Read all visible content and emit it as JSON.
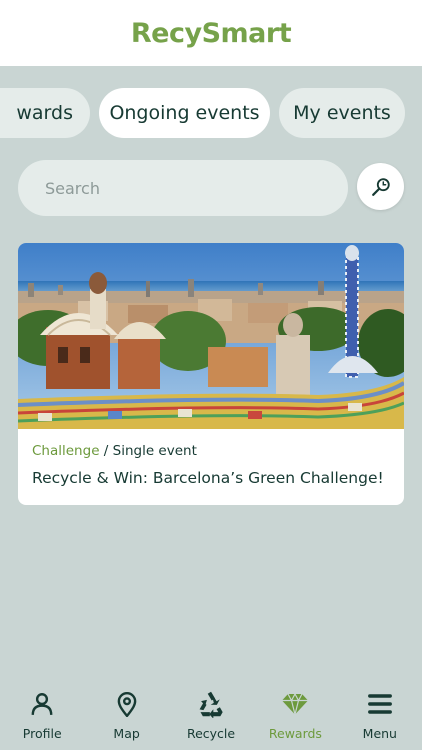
{
  "app": {
    "logo": "RecySmart",
    "brand_color": "#76a24a"
  },
  "tabs": [
    {
      "label": "Rewards",
      "visible_text": "wards"
    },
    {
      "label": "Ongoing events",
      "selected": true
    },
    {
      "label": "My events"
    }
  ],
  "search": {
    "placeholder": "Search",
    "icon": "search-icon"
  },
  "events": [
    {
      "category": "Challenge",
      "separator": " / ",
      "type": "Single event",
      "title": "Recycle & Win: Barcelona’s Green Challenge!",
      "image": "barcelona-park-guell"
    }
  ],
  "nav": [
    {
      "label": "Profile",
      "icon": "person-icon"
    },
    {
      "label": "Map",
      "icon": "map-pin-icon"
    },
    {
      "label": "Recycle",
      "icon": "recycle-icon"
    },
    {
      "label": "Rewards",
      "icon": "diamond-icon",
      "active": true
    },
    {
      "label": "Menu",
      "icon": "menu-icon"
    }
  ],
  "colors": {
    "background": "#c9d5d3",
    "text": "#173a33",
    "active": "#6d9a3d"
  }
}
